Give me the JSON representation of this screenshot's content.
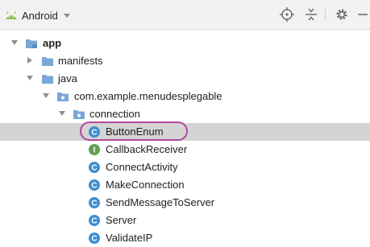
{
  "toolbar": {
    "view_label": "Android",
    "icons": [
      "android-icon",
      "dropdown-caret-icon",
      "crosshair-icon",
      "collapse-all-icon",
      "gear-icon",
      "minimize-icon"
    ]
  },
  "tree": {
    "app": "app",
    "manifests": "manifests",
    "java": "java",
    "package": "com.example.menudesplegable",
    "connection": "connection",
    "classes": [
      {
        "label": "ButtonEnum",
        "kind": "class",
        "selected": true
      },
      {
        "label": "CallbackReceiver",
        "kind": "interface"
      },
      {
        "label": "ConnectActivity",
        "kind": "class"
      },
      {
        "label": "MakeConnection",
        "kind": "class"
      },
      {
        "label": "SendMessageToServer",
        "kind": "class"
      },
      {
        "label": "Server",
        "kind": "class"
      },
      {
        "label": "ValidateIP",
        "kind": "class"
      }
    ]
  },
  "colors": {
    "class_icon": "#3e8ed0",
    "interface_icon": "#5fa04e",
    "folder": "#7aa7d6",
    "highlight_ring": "#b0479a",
    "selected_row": "#d4d4d4"
  }
}
